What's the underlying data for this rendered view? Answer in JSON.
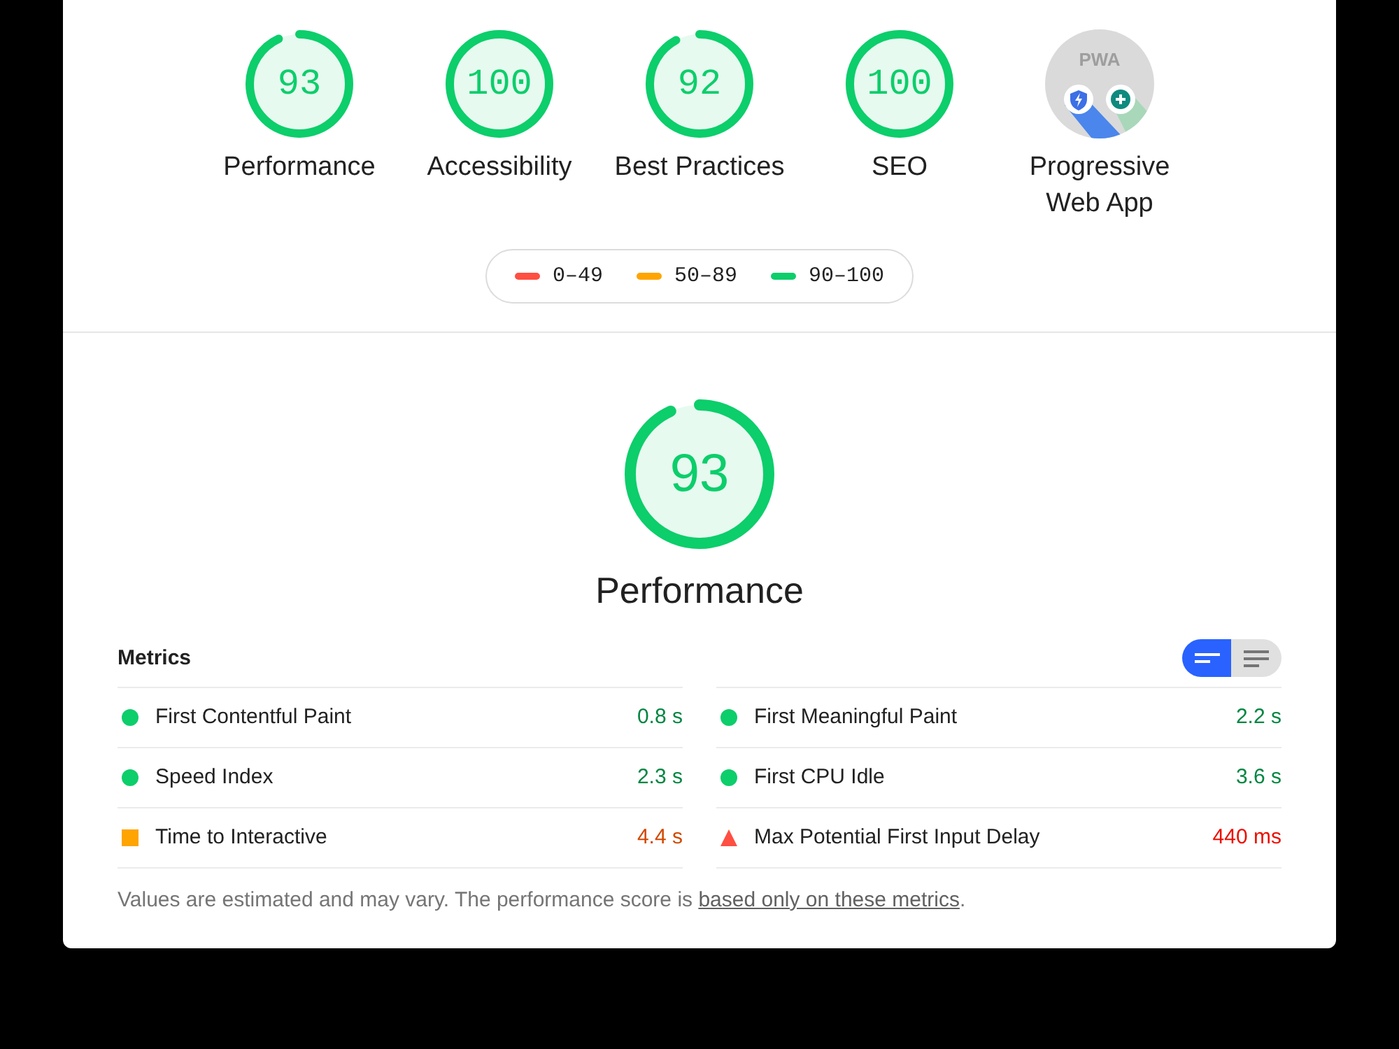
{
  "categories": [
    {
      "kind": "gauge",
      "score": "93",
      "level": 0.93,
      "label": "Performance"
    },
    {
      "kind": "gauge",
      "score": "100",
      "level": 1,
      "label": "Accessibility"
    },
    {
      "kind": "gauge",
      "score": "92",
      "level": 0.92,
      "label": "Best Practices"
    },
    {
      "kind": "gauge",
      "score": "100",
      "level": 1,
      "label": "SEO"
    },
    {
      "kind": "pwa",
      "logo_text": "PWA",
      "label": "Progressive Web App"
    }
  ],
  "legend": [
    {
      "label": "0–49",
      "color": "#ff4e42"
    },
    {
      "label": "50–89",
      "color": "#ffa400"
    },
    {
      "label": "90–100",
      "color": "#0cce6b"
    }
  ],
  "performance": {
    "score": "93",
    "level": 0.93,
    "title": "Performance"
  },
  "metrics_title": "Metrics",
  "view_toggle": [
    {
      "selected": true
    },
    {
      "selected": false
    }
  ],
  "metrics": [
    {
      "label": "First Contentful Paint",
      "value": "0.8 s",
      "kind": "pass"
    },
    {
      "label": "First Meaningful Paint",
      "value": "2.2 s",
      "kind": "pass"
    },
    {
      "label": "Speed Index",
      "value": "2.3 s",
      "kind": "pass"
    },
    {
      "label": "First CPU Idle",
      "value": "3.6 s",
      "kind": "pass"
    },
    {
      "label": "Time to Interactive",
      "value": "4.4 s",
      "kind": "average"
    },
    {
      "label": "Max Potential First Input Delay",
      "value": "440 ms",
      "kind": "fail"
    }
  ],
  "footnote": {
    "text": "Values are estimated and may vary. The performance score is ",
    "link": "based only on these metrics",
    "after": "."
  }
}
